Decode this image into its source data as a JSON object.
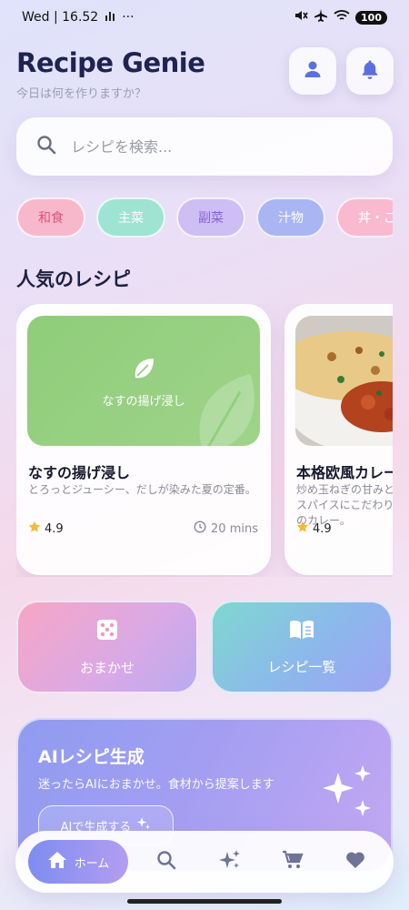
{
  "status_bar": {
    "time": "Wed | 16.52",
    "dots": "···",
    "battery": "100"
  },
  "header": {
    "title": "Recipe Genie",
    "subtitle": "今日は何を作りますか？"
  },
  "search": {
    "placeholder": "レシピを検索..."
  },
  "categories": [
    {
      "label": "和食",
      "bg": "#f7b8cc",
      "color": "#e0507e"
    },
    {
      "label": "主菜",
      "bg": "#9fe3d2",
      "color": "#ffffff"
    },
    {
      "label": "副菜",
      "bg": "#cdbef4",
      "color": "#8a63d8"
    },
    {
      "label": "汁物",
      "bg": "#a9b6f3",
      "color": "#ffffff"
    },
    {
      "label": "丼・ご",
      "bg": "#f9b9cf",
      "color": "#ffffff"
    }
  ],
  "popular": {
    "title": "人気のレシピ",
    "recipes": [
      {
        "image_label": "なすの揚げ浸し",
        "title": "なすの揚げ浸し",
        "description": "とろっとジューシー、だしが染みた夏の定番。",
        "rating": "4.9",
        "time": "20 mins"
      },
      {
        "title": "本格欧風カレー",
        "description": "炒め玉ねぎの甘みとスパイスにこだわりのカレー。",
        "rating": "4.9"
      }
    ]
  },
  "actions": {
    "random_label": "おまかせ",
    "list_label": "レシピ一覧"
  },
  "ai_card": {
    "title": "AIレシピ生成",
    "description": "迷ったらAIにおまかせ。食材から提案します",
    "button_label": "AIで生成する"
  },
  "bottom_nav": {
    "home_label": "ホーム"
  },
  "colors": {
    "accent": "#5b6ee1",
    "star": "#f5b93a",
    "green_card": "#8fcd7a"
  }
}
